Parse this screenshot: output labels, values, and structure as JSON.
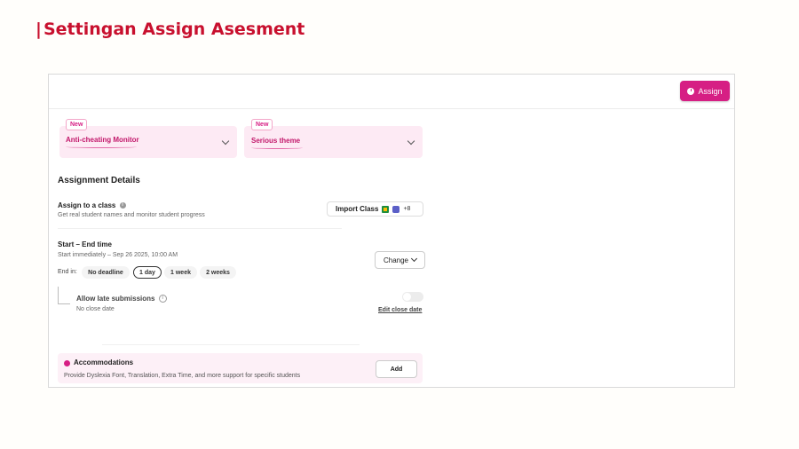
{
  "slide": {
    "title": "Settingan Assign Asesment",
    "title_prefix": "|"
  },
  "toolbar": {
    "assign_label": "Assign",
    "assign_icon": "clock-icon",
    "accent_color": "#d61f84"
  },
  "feature_cards": [
    {
      "badge": "New",
      "label": "Anti-cheating Monitor"
    },
    {
      "badge": "New",
      "label": "Serious theme"
    }
  ],
  "assignment_details": {
    "heading": "Assignment Details",
    "assign_class": {
      "title": "Assign to a class",
      "subtitle": "Get real student names and monitor student progress",
      "import_label": "Import Class",
      "more_count": "+8"
    },
    "schedule": {
      "title": "Start – End time",
      "subtitle": "Start immediately  –  Sep 26 2025, 10:00 AM",
      "change_label": "Change",
      "end_in_label": "End in:",
      "durations": [
        "No deadline",
        "1 day",
        "1 week",
        "2 weeks"
      ],
      "selected_duration": "1 day"
    },
    "late_submissions": {
      "title": "Allow late submissions",
      "subtitle": "No close date",
      "edit_link": "Edit close date",
      "enabled": false
    }
  },
  "accommodations": {
    "title": "Accommodations",
    "subtitle": "Provide Dyslexia Font, Translation, Extra Time, and more support for specific students",
    "add_label": "Add"
  }
}
